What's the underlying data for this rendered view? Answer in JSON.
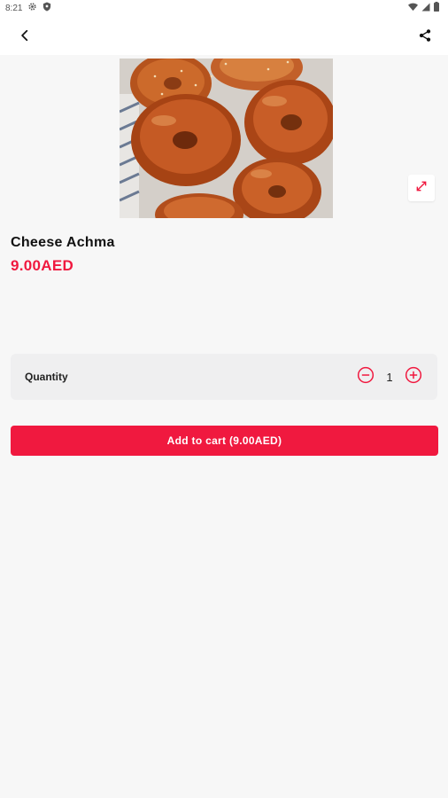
{
  "status_bar": {
    "time": "8:21",
    "icons": [
      "gear-icon",
      "shield-icon",
      "wifi-icon",
      "signal-icon",
      "battery-icon"
    ]
  },
  "app_bar": {
    "back_icon": "back-arrow-icon",
    "share_icon": "share-icon"
  },
  "product": {
    "name": "Cheese Achma",
    "price": "9.00AED",
    "image_icon": "bread-photo",
    "expand_icon": "expand-icon"
  },
  "quantity": {
    "label": "Quantity",
    "value": "1",
    "decrement_icon": "minus-circle-icon",
    "increment_icon": "plus-circle-icon"
  },
  "cart": {
    "add_label": "Add to cart (9.00AED)"
  },
  "colors": {
    "accent": "#f0193f",
    "background": "#f7f7f7",
    "card": "#efeff0"
  }
}
